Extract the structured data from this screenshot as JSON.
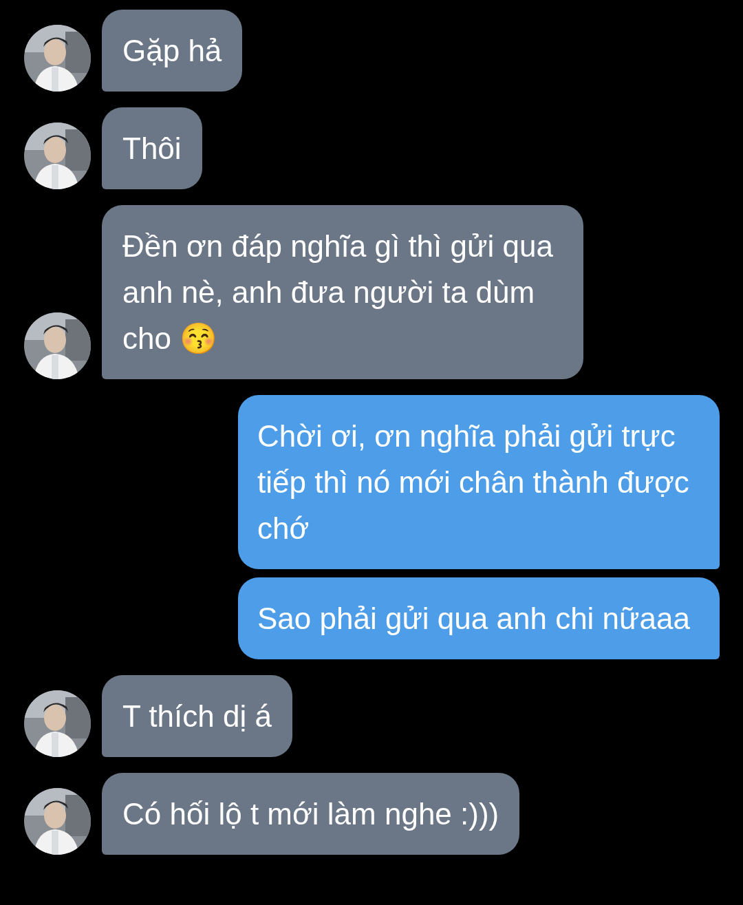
{
  "messages": [
    {
      "kind": "incoming",
      "text": "Gặp hả"
    },
    {
      "kind": "incoming",
      "text": "Thôi"
    },
    {
      "kind": "incoming",
      "text": "Đền ơn đáp nghĩa gì thì gửi qua anh nè, anh đưa người ta dùm cho 😚"
    },
    {
      "kind": "outgoing",
      "text": "Chời ơi, ơn nghĩa phải gửi trực tiếp thì nó mới chân thành được chớ"
    },
    {
      "kind": "outgoing",
      "text": "Sao phải gửi qua anh chi nữaaa"
    },
    {
      "kind": "incoming",
      "text": "T thích dị á"
    },
    {
      "kind": "incoming",
      "text": "Có hối lộ t mới làm nghe :)))"
    }
  ]
}
